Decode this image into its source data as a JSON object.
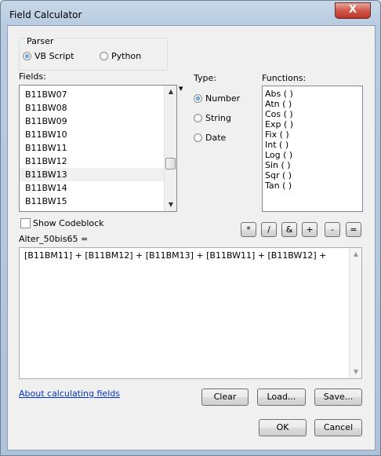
{
  "window": {
    "title": "Field Calculator",
    "close_label": "X"
  },
  "parser": {
    "group_label": "Parser",
    "options": [
      {
        "label": "VB Script",
        "selected": true
      },
      {
        "label": "Python",
        "selected": false
      }
    ]
  },
  "fields": {
    "label": "Fields:",
    "items": [
      "B11BW07",
      "B11BW08",
      "B11BW09",
      "B11BW10",
      "B11BW11",
      "B11BW12",
      "B11BW13",
      "B11BW14",
      "B11BW15"
    ],
    "highlighted": "B11BW13"
  },
  "type": {
    "label": "Type:",
    "options": [
      {
        "label": "Number",
        "selected": true
      },
      {
        "label": "String",
        "selected": false
      },
      {
        "label": "Date",
        "selected": false
      }
    ]
  },
  "functions": {
    "label": "Functions:",
    "items": [
      "Abs ( )",
      "Atn ( )",
      "Cos ( )",
      "Exp ( )",
      "Fix ( )",
      "Int ( )",
      "Log ( )",
      "Sin ( )",
      "Sqr ( )",
      "Tan ( )"
    ]
  },
  "show_codeblock": {
    "label": "Show Codeblock",
    "checked": false
  },
  "operators": [
    "*",
    "/",
    "&",
    "+",
    "-",
    "="
  ],
  "expression": {
    "target_label": "Alter_50bis65 =",
    "value": "[B11BM11] + [B11BM12] + [B11BM13] + [B11BW11] + [B11BW12] +"
  },
  "help_link": "About calculating fields",
  "buttons": {
    "clear": "Clear",
    "load": "Load...",
    "save": "Save...",
    "ok": "OK",
    "cancel": "Cancel"
  }
}
